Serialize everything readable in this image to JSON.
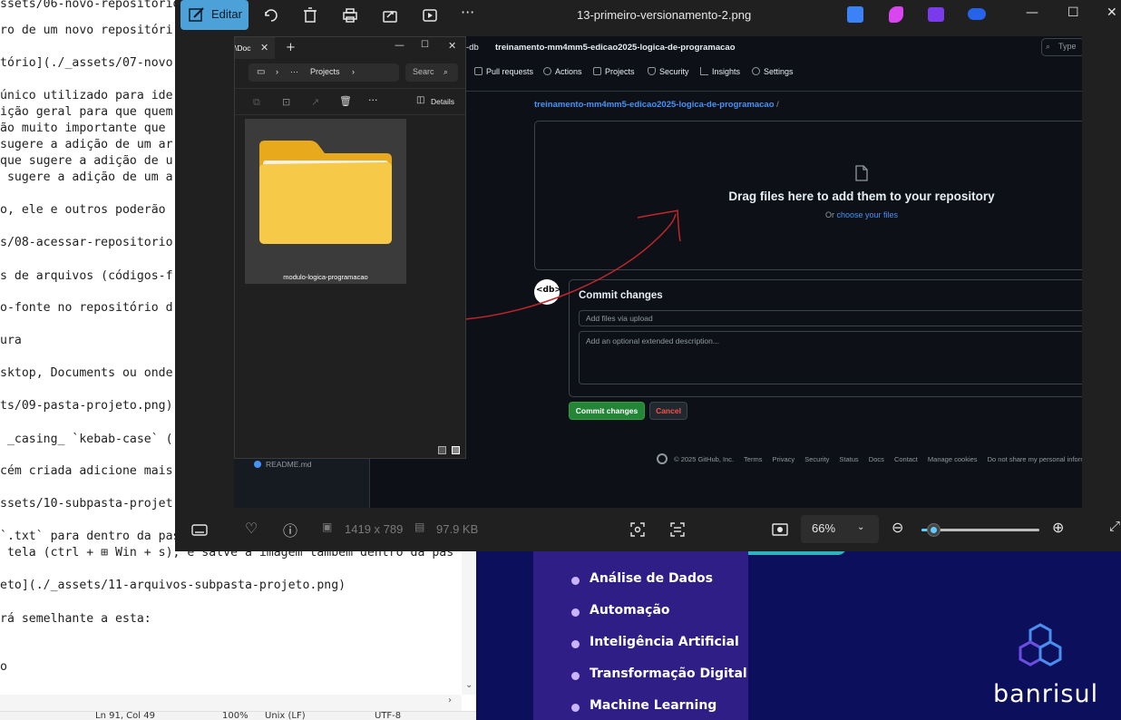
{
  "editor": {
    "lines": [
      "ssets/06-novo-repositório",
      "ro de um novo repositóri",
      "tório](./_assets/07-novo",
      "único utilizado para ide",
      "ição geral para que quem",
      "ão muito importante que",
      "sugere a adição de um ar",
      "que sugere a adição de u",
      " sugere a adição de um a",
      "o, ele e outros poderão",
      "s/08-acessar-repositorio",
      "s de arquivos (códigos-f",
      "o-fonte no repositório d",
      "ura",
      "sktop, Documents ou onde",
      "ts/09-pasta-projeto.png)",
      " _casing_ `kebab-case` (",
      "cém criada adicione mais",
      "ssets/10-subpasta-projet",
      "`.txt` para dentro da pasta",
      " tela (ctrl + ⊞ Win + s), e salve a imagem também dentro da pas",
      "eto](./_assets/11-arquivos-subpasta-projeto.png)",
      "rá semelhante a esta:",
      "o"
    ],
    "status": [
      "Ln 91, Col 49",
      "100%",
      "Unix (LF)",
      "UTF-8"
    ]
  },
  "slide": {
    "items": [
      "Análise de Dados",
      "Automação",
      "Inteligência Artificial",
      "Transformação Digital",
      "Machine Learning"
    ],
    "brand": "banrisul",
    "colors": {
      "background": "#0c0f5c",
      "panel": "#2e1e86",
      "bullet": "#c9b4ff"
    }
  },
  "viewer": {
    "edit_label": "Editar",
    "title": "13-primeiro-versionamento-2.png",
    "dimensions": "1419 x 789",
    "file_size": "97.9 KB",
    "zoom": "66%",
    "zoom_level": 0.1
  },
  "github": {
    "owner_suffix": "-db",
    "repo_name": "treinamento-mm4mm5-edicao2025-logica-de-programacao",
    "search_placeholder": "Type",
    "tabs": [
      "Pull requests",
      "Actions",
      "Projects",
      "Security",
      "Insights",
      "Settings"
    ],
    "breadcrumb": "treinamento-mm4mm5-edicao2025-logica-de-programacao",
    "breadcrumb_sep": "/",
    "drop_title": "Drag files here to add them to your repository",
    "drop_or": "Or",
    "drop_link": "choose your files",
    "avatar_text": "<db>",
    "commit_title": "Commit changes",
    "commit_placeholder": "Add files via upload",
    "description_placeholder": "Add an optional extended description...",
    "commit_button": "Commit changes",
    "cancel_button": "Cancel",
    "footer": [
      "© 2025 GitHub, Inc.",
      "Terms",
      "Privacy",
      "Security",
      "Status",
      "Docs",
      "Contact",
      "Manage cookies",
      "Do not share my personal information"
    ],
    "readme": "README.md",
    "colors": {
      "link": "#4493f8",
      "commit_green": "#238636",
      "cancel_red": "#f85149"
    }
  },
  "explorer": {
    "tab_label": "\\Doc",
    "address_current": "Projects",
    "search_placeholder": "Searc",
    "details_label": "Details",
    "folder_name": "modulo-logica-programacao",
    "folder_color": "#f7c948"
  },
  "icons": {
    "titlebar": [
      "edit-icon",
      "rotate-icon",
      "delete-icon",
      "print-icon",
      "share-icon",
      "slideshow-icon",
      "more-icon"
    ],
    "bottombar": [
      "filmstrip-icon",
      "favorite-icon",
      "info-icon",
      "resolution-icon",
      "filesize-icon",
      "select-icon",
      "text-scan-icon",
      "fit-icon",
      "zoom-out-icon",
      "zoom-in-icon",
      "fullscreen-icon"
    ]
  }
}
